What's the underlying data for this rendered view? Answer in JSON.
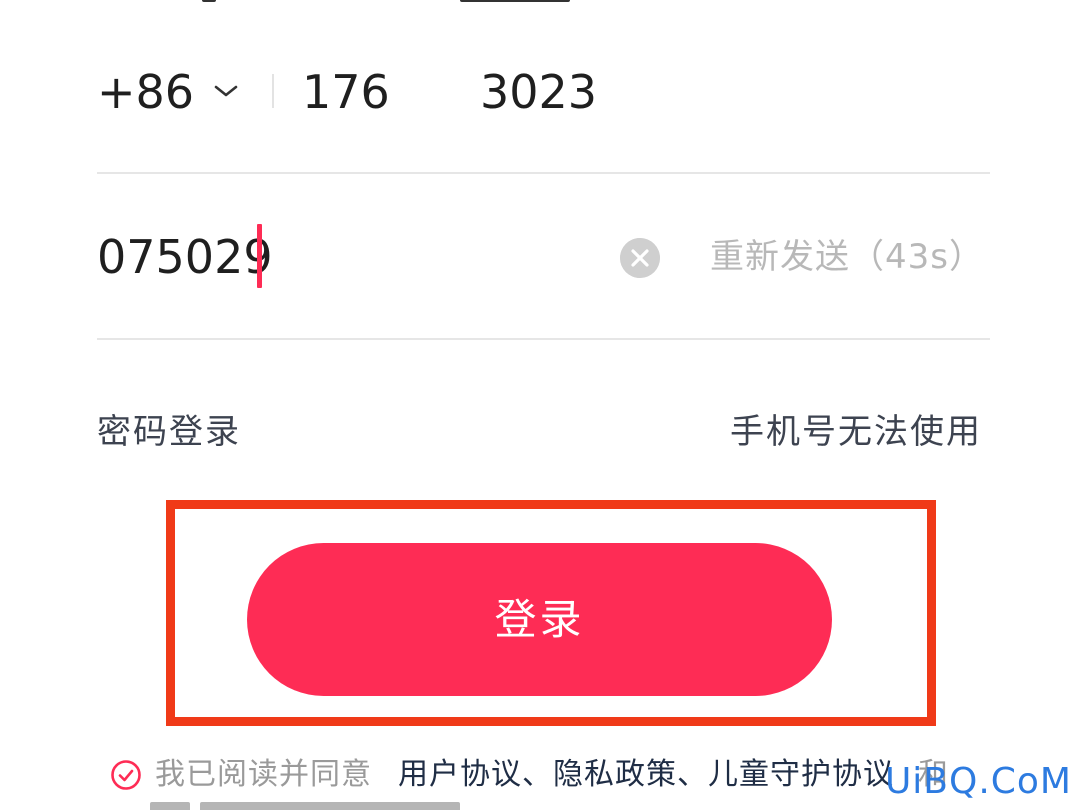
{
  "phone": {
    "country_code": "+86",
    "number_part1": "176",
    "number_part2": "3023"
  },
  "verification": {
    "code_value": "075029",
    "resend_label": "重新发送（43s）"
  },
  "links": {
    "password_login": "密码登录",
    "phone_unavailable": "手机号无法使用"
  },
  "login_button": {
    "label": "登录"
  },
  "agreement": {
    "prefix": "我已阅读并同意",
    "links": "用户协议、隐私政策、儿童守护协议",
    "suffix": "和"
  },
  "watermark": {
    "text": "UiBQ.CoM"
  },
  "colors": {
    "accent": "#fe2c55",
    "highlight": "#f03a18",
    "watermark": "#2d7be0"
  },
  "icons": [
    "chevron-down-icon",
    "clear-icon",
    "check-circle-icon"
  ]
}
